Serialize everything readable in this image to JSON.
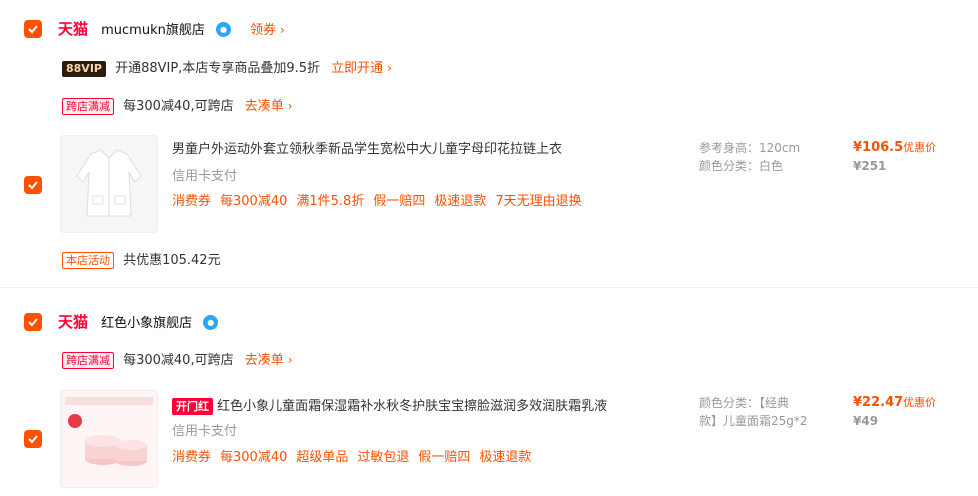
{
  "shops": [
    {
      "brand_badge": "天猫",
      "name": "mucmukn旗舰店",
      "coupon_link": "领券",
      "vip_badge": "88VIP",
      "vip_text": "开通88VIP,本店专享商品叠加9.5折",
      "vip_link": "立即开通",
      "promo_tag": "跨店满减",
      "promo_text": "每300减40,可跨店",
      "promo_link": "去凑单",
      "item": {
        "title": "男童户外运动外套立领秋季新品学生宽松中大儿童字母印花拉链上衣",
        "payment": "信用卡支付",
        "tags": [
          "消费券",
          "每300减40",
          "满1件5.8折",
          "假一赔四",
          "极速退款",
          "7天无理由退换"
        ],
        "spec1": "参考身高：120cm",
        "spec2": "颜色分类：白色",
        "price": "¥106.5",
        "price_note": "优惠价",
        "old_price": "¥251"
      },
      "activity_tag": "本店活动",
      "activity_text": "共优惠105.42元"
    },
    {
      "brand_badge": "天猫",
      "name": "红色小象旗舰店",
      "promo_tag": "跨店满减",
      "promo_text": "每300减40,可跨店",
      "promo_link": "去凑单",
      "item": {
        "badge": "开门红",
        "title": "红色小象儿童面霜保湿霜补水秋冬护肤宝宝擦脸滋润多效润肤霜乳液",
        "payment": "信用卡支付",
        "tags": [
          "消费券",
          "每300减40",
          "超级单品",
          "过敏包退",
          "假一赔四",
          "极速退款"
        ],
        "spec1": "颜色分类：【经典",
        "spec2": "款】儿童面霜25g*2",
        "price": "¥22.47",
        "price_note": "优惠价",
        "old_price": "¥49"
      }
    }
  ],
  "colors": {
    "accent": "#ff5000",
    "tmall": "#ff0036"
  }
}
